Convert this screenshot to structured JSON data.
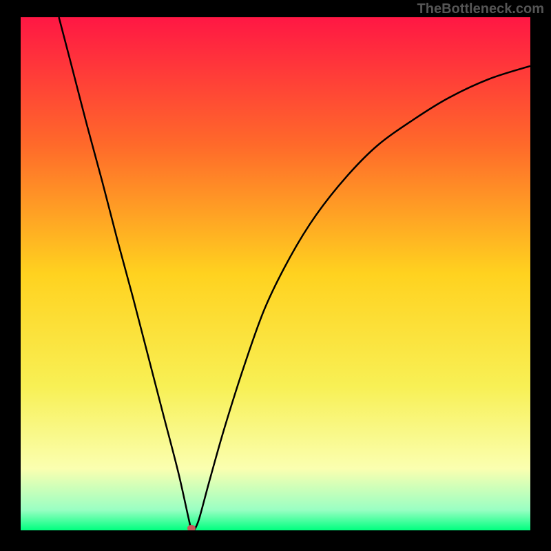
{
  "watermark": "TheBottleneck.com",
  "chart_data": {
    "type": "line",
    "title": "",
    "xlabel": "",
    "ylabel": "",
    "xlim": [
      0,
      1
    ],
    "ylim": [
      0,
      1
    ],
    "background_gradient": {
      "stops": [
        {
          "offset": 0.0,
          "color": "#ff1744"
        },
        {
          "offset": 0.25,
          "color": "#ff6a2a"
        },
        {
          "offset": 0.5,
          "color": "#ffd21f"
        },
        {
          "offset": 0.72,
          "color": "#f8f055"
        },
        {
          "offset": 0.88,
          "color": "#faffb0"
        },
        {
          "offset": 0.96,
          "color": "#9affc3"
        },
        {
          "offset": 1.0,
          "color": "#00ff7f"
        }
      ]
    },
    "min_marker": {
      "x": 0.335,
      "y": 0.0,
      "color": "#c85a5a"
    },
    "series": [
      {
        "name": "bottleneck-curve",
        "color": "#000000",
        "x": [
          0.075,
          0.1,
          0.13,
          0.16,
          0.19,
          0.22,
          0.25,
          0.28,
          0.31,
          0.335,
          0.34,
          0.35,
          0.37,
          0.4,
          0.44,
          0.48,
          0.53,
          0.58,
          0.64,
          0.7,
          0.77,
          0.84,
          0.92,
          1.0
        ],
        "y": [
          1.0,
          0.905,
          0.79,
          0.68,
          0.565,
          0.455,
          0.34,
          0.225,
          0.11,
          0.0,
          0.0,
          0.022,
          0.095,
          0.2,
          0.325,
          0.435,
          0.535,
          0.615,
          0.69,
          0.75,
          0.8,
          0.843,
          0.88,
          0.905
        ]
      }
    ]
  }
}
